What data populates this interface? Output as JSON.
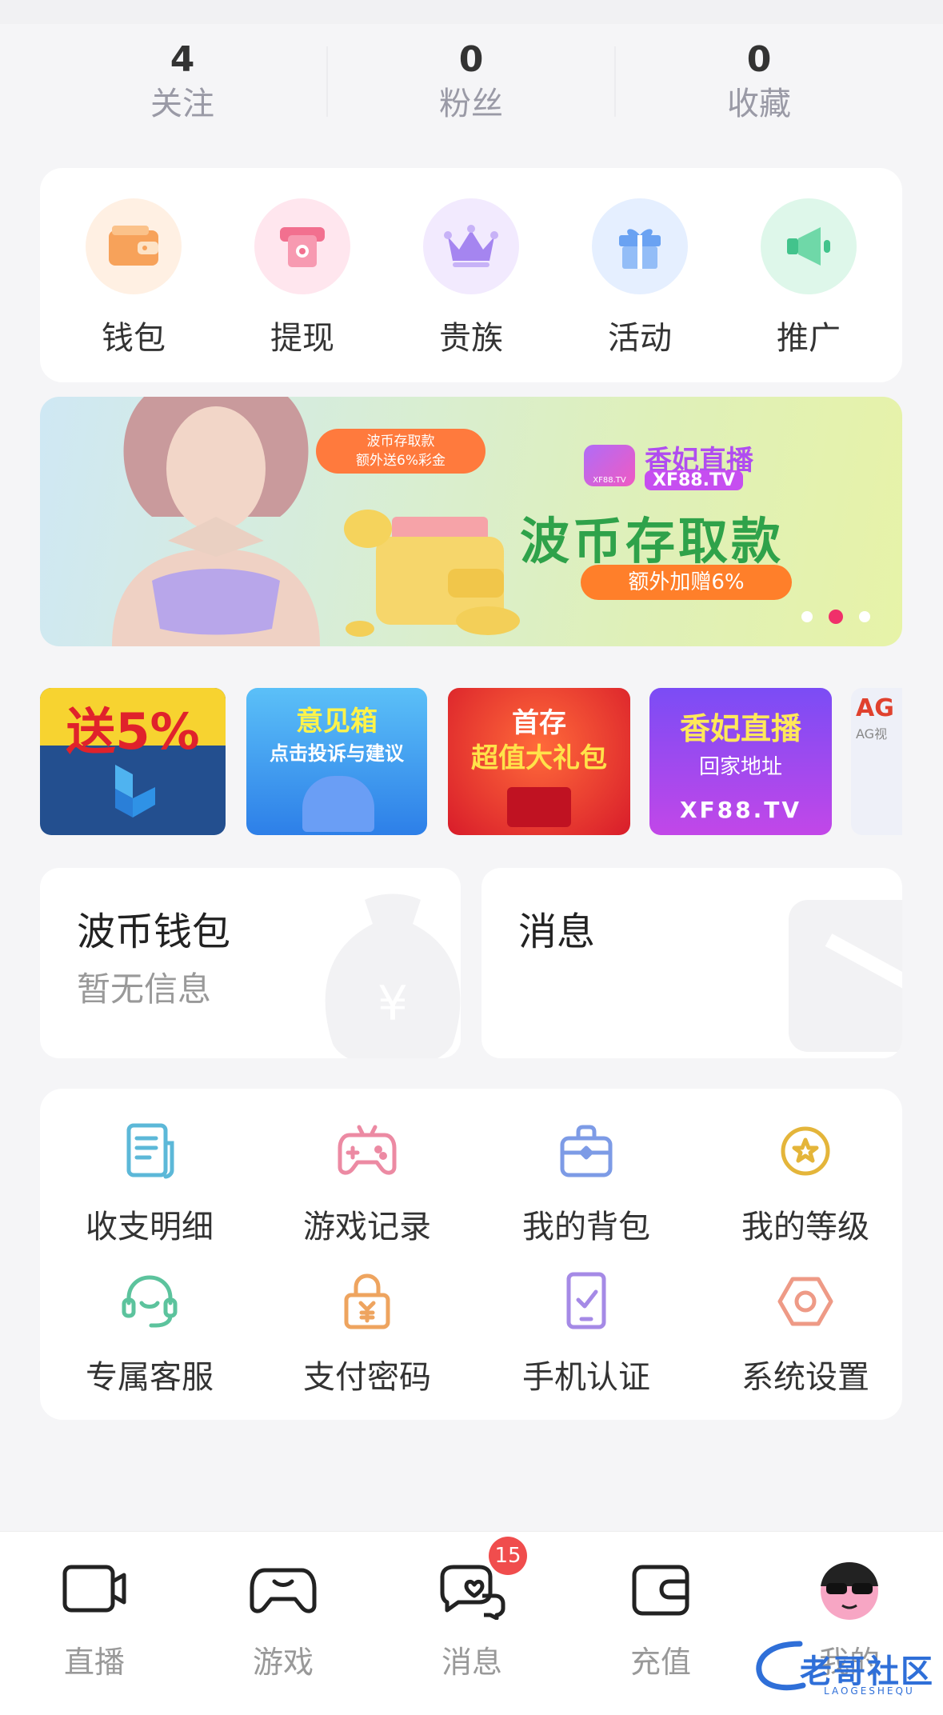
{
  "stats": [
    {
      "value": "4",
      "label": "关注"
    },
    {
      "value": "0",
      "label": "粉丝"
    },
    {
      "value": "0",
      "label": "收藏"
    }
  ],
  "quick": [
    {
      "label": "钱包",
      "icon": "wallet-icon",
      "color": "#f7a25a"
    },
    {
      "label": "提现",
      "icon": "withdraw-icon",
      "color": "#f2708f"
    },
    {
      "label": "贵族",
      "icon": "crown-icon",
      "color": "#a585f0"
    },
    {
      "label": "活动",
      "icon": "gift-icon",
      "color": "#6aa2f2"
    },
    {
      "label": "推广",
      "icon": "megaphone-icon",
      "color": "#42c38c"
    }
  ],
  "banner": {
    "bubble_line1": "波币存取款",
    "bubble_line2": "额外送6%彩金",
    "brand_small": "XF88.TV",
    "brand_cn": "香妃直播",
    "brand_tv": "XF88.TV",
    "headline": "波币存取款",
    "pill": "额外加赠6%"
  },
  "promos": [
    {
      "line1": "送5%",
      "line2": ""
    },
    {
      "line1": "意见箱",
      "line2": "点击投诉与建议"
    },
    {
      "line1": "首存",
      "line2": "超值大礼包"
    },
    {
      "line1": "香妃直播",
      "line2": "回家地址",
      "line3": "XF88.TV"
    },
    {
      "line1": "AG",
      "line2": "AG视"
    }
  ],
  "wallet_card": {
    "title": "波币钱包",
    "subtitle": "暂无信息"
  },
  "message_card": {
    "title": "消息"
  },
  "grid": [
    {
      "label": "收支明细",
      "icon": "ledger-icon"
    },
    {
      "label": "游戏记录",
      "icon": "gamepad-icon"
    },
    {
      "label": "我的背包",
      "icon": "backpack-icon"
    },
    {
      "label": "我的等级",
      "icon": "star-badge-icon"
    },
    {
      "label": "专属客服",
      "icon": "headset-icon"
    },
    {
      "label": "支付密码",
      "icon": "lock-icon"
    },
    {
      "label": "手机认证",
      "icon": "phone-check-icon"
    },
    {
      "label": "系统设置",
      "icon": "settings-icon"
    }
  ],
  "tabs": [
    {
      "label": "直播",
      "icon": "camera-icon"
    },
    {
      "label": "游戏",
      "icon": "game-controller-icon"
    },
    {
      "label": "消息",
      "icon": "chat-icon",
      "badge": "15"
    },
    {
      "label": "充值",
      "icon": "wallet-tab-icon"
    },
    {
      "label": "我的",
      "icon": "avatar-icon"
    }
  ],
  "watermark": {
    "text": "老哥社区",
    "sub": "LAOGESHEQU"
  }
}
